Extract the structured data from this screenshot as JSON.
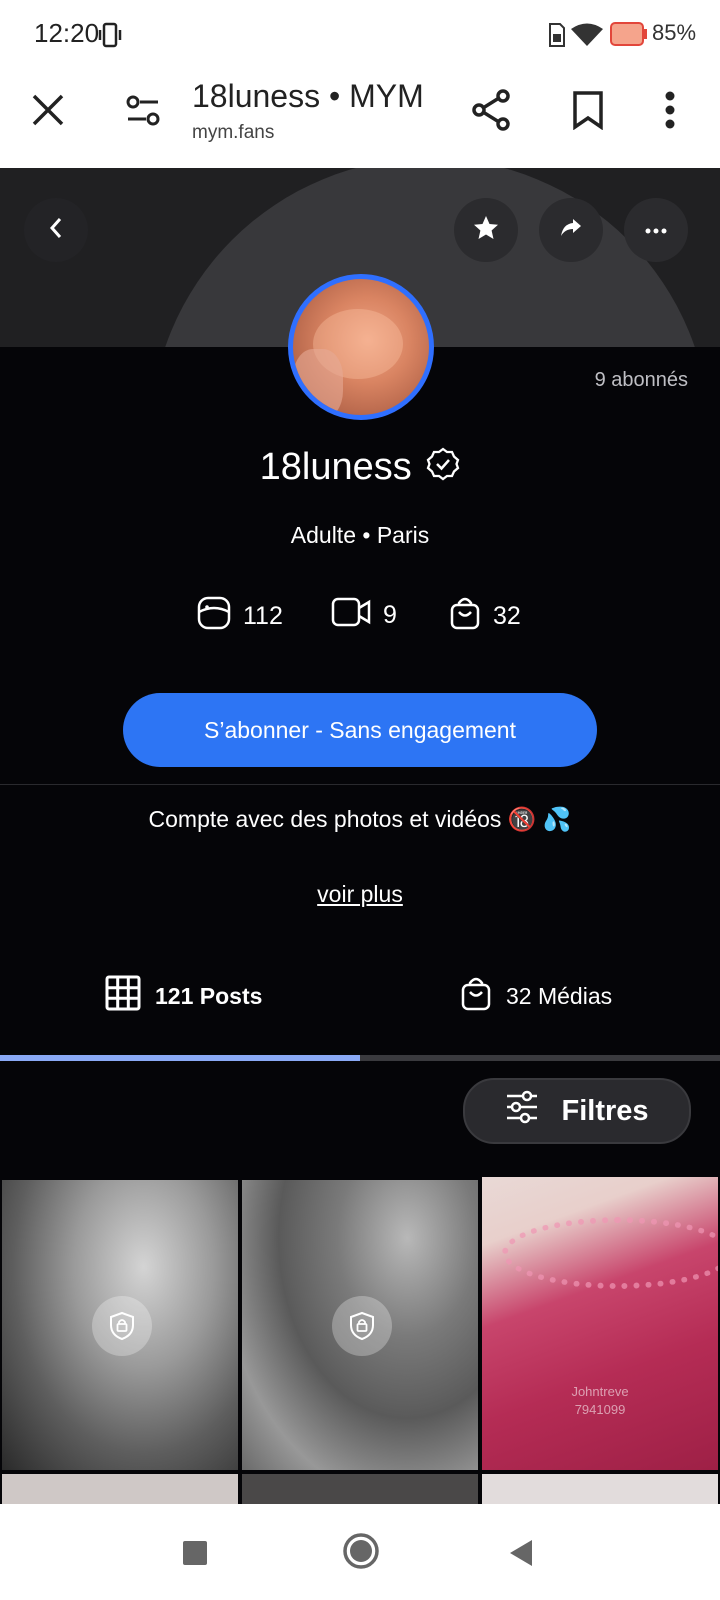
{
  "status": {
    "time": "12:20",
    "battery": "85%"
  },
  "browser": {
    "title": "18luness • MYM",
    "url": "mym.fans"
  },
  "profile": {
    "subscribers": "9 abonnés",
    "name": "18luness",
    "meta": "Adulte • Paris",
    "stats": {
      "posts": "112",
      "videos": "9",
      "media": "32"
    },
    "subscribe_label": "S’abonner - Sans engagement",
    "description": "Compte avec des photos et vidéos 🔞 💦",
    "see_more": "voir plus"
  },
  "tabs": {
    "posts_label": "121 Posts",
    "media_label": "32 Médias",
    "active_fraction": 0.5
  },
  "filters": {
    "label": "Filtres"
  },
  "grid": {
    "watermark_line1": "Johntreve",
    "watermark_line2": "7941099"
  },
  "colors": {
    "accent": "#2d75f4",
    "tab_indicator": "#8aa9f5",
    "avatar_ring": "#2f6fff"
  }
}
